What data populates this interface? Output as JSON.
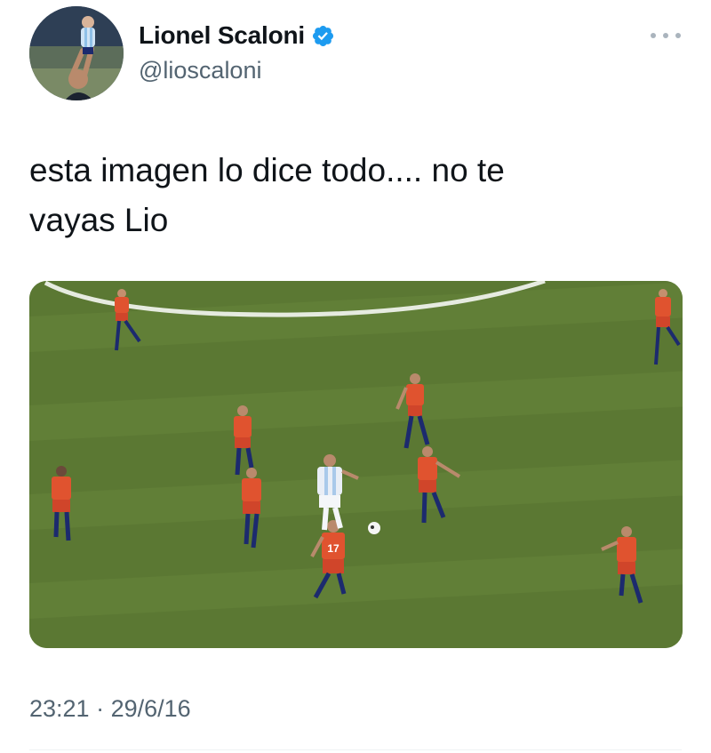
{
  "author": {
    "display_name": "Lionel Scaloni",
    "handle": "@lioscaloni",
    "verified": true,
    "verified_icon": "verified-badge-icon",
    "avatar_icon": "avatar-photo"
  },
  "menu": {
    "icon": "more-horizontal-icon"
  },
  "tweet": {
    "text_line_1": "esta imagen lo dice todo.... no te",
    "text_line_2": "vayas Lio",
    "media_alt": "photo"
  },
  "meta": {
    "time": "23:21",
    "separator": "·",
    "date": "29/6/16"
  },
  "media": {
    "jersey_number": "17",
    "colors": {
      "pitch": "#5b7833",
      "pitch_stripe": "#67853b",
      "red_kit": "#e0532f",
      "shorts_red": "#d0452a",
      "socks_blue": "#1c2a6e",
      "white_kit": "#e9eef6",
      "line": "#e6ebe0"
    }
  },
  "colors": {
    "accent_verified": "#1d9bf0",
    "text_primary": "#0f1419",
    "text_secondary": "#536471"
  }
}
